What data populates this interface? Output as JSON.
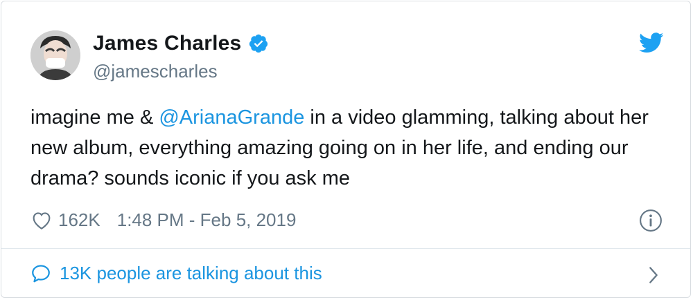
{
  "tweet": {
    "author": {
      "name": "James Charles",
      "handle": "@jamescharles",
      "verified": true
    },
    "text": {
      "part1": "imagine me & ",
      "mention": "@ArianaGrande",
      "part2": " in a video glamming, talking about her new album, everything amazing going on in her life, and ending our drama? sounds iconic if you ask me"
    },
    "likes": "162K",
    "timestamp": "1:48 PM - Feb 5, 2019",
    "conversation_label": "13K people are talking about this"
  },
  "icons": {
    "verified": "verified-badge-icon",
    "brand": "twitter-bird-icon",
    "like": "heart-icon",
    "info": "info-icon",
    "reply": "speech-bubble-icon",
    "more": "chevron-right-icon"
  },
  "colors": {
    "accent": "#1b95e0",
    "text": "#14171a",
    "secondary": "#657786",
    "border": "#e1e8ed"
  }
}
